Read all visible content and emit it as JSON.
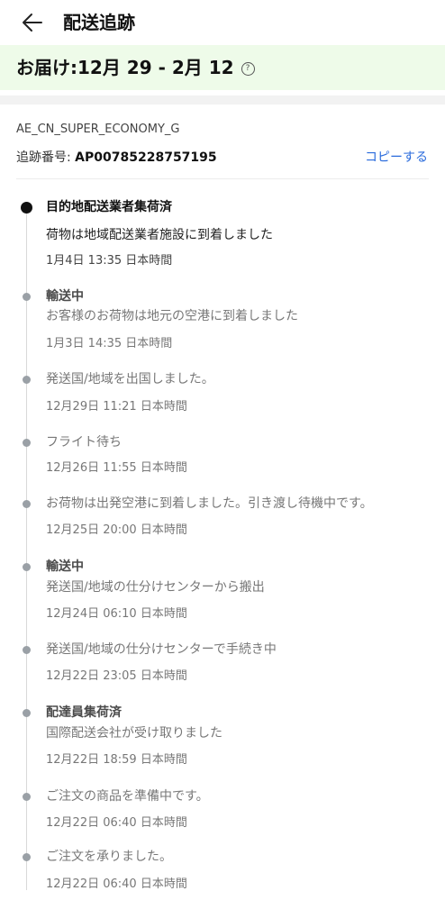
{
  "header": {
    "title": "配送追跡",
    "back_icon": "arrow-left-icon"
  },
  "eta": {
    "label": "お届け:12月 29 - 2月 12",
    "help_icon": "question-circle-icon",
    "background": "#eefbe9"
  },
  "shipment": {
    "service": "AE_CN_SUPER_ECONOMY_G",
    "tracking_label": "追跡番号: ",
    "tracking_number": "AP00785228757195",
    "copy_label": "コピーする",
    "accent": "#2a6bdc"
  },
  "events": [
    {
      "title": "目的地配送業者集荷済",
      "desc": "荷物は地域配送業者施設に到着しました",
      "time": "1月4日 13:35 日本時間"
    },
    {
      "title": "輸送中",
      "desc": "お客様のお荷物は地元の空港に到着しました",
      "time": "1月3日 14:35 日本時間"
    },
    {
      "title": "",
      "desc": "発送国/地域を出国しました。",
      "time": "12月29日 11:21 日本時間"
    },
    {
      "title": "",
      "desc": "フライト待ち",
      "time": "12月26日 11:55 日本時間"
    },
    {
      "title": "",
      "desc": "お荷物は出発空港に到着しました。引き渡し待機中です。",
      "time": "12月25日 20:00 日本時間"
    },
    {
      "title": "輸送中",
      "desc": "発送国/地域の仕分けセンターから搬出",
      "time": "12月24日 06:10 日本時間"
    },
    {
      "title": "",
      "desc": "発送国/地域の仕分けセンターで手続き中",
      "time": "12月22日 23:05 日本時間"
    },
    {
      "title": "配達員集荷済",
      "desc": "国際配送会社が受け取りました",
      "time": "12月22日 18:59 日本時間"
    },
    {
      "title": "",
      "desc": "ご注文の商品を準備中です。",
      "time": "12月22日 06:40 日本時間"
    },
    {
      "title": "",
      "desc": "ご注文を承りました。",
      "time": "12月22日 06:40 日本時間"
    }
  ]
}
